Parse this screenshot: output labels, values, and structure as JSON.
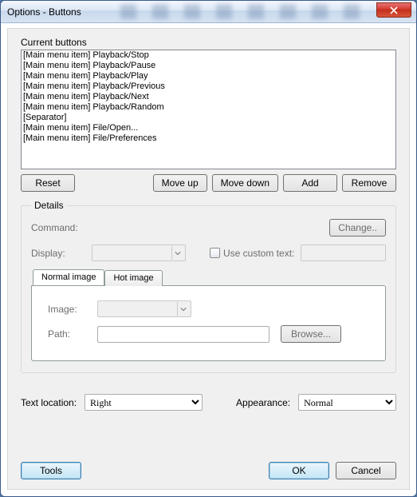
{
  "window": {
    "title": "Options - Buttons"
  },
  "section_label": "Current buttons",
  "current_buttons": [
    "[Main menu item] Playback/Stop",
    "[Main menu item] Playback/Pause",
    "[Main menu item] Playback/Play",
    "[Main menu item] Playback/Previous",
    "[Main menu item] Playback/Next",
    "[Main menu item] Playback/Random",
    "[Separator]",
    "[Main menu item] File/Open...",
    "[Main menu item] File/Preferences"
  ],
  "buttons": {
    "reset": "Reset",
    "move_up": "Move up",
    "move_down": "Move down",
    "add": "Add",
    "remove": "Remove"
  },
  "details": {
    "legend": "Details",
    "command_label": "Command:",
    "change": "Change..",
    "display_label": "Display:",
    "use_custom_text": "Use custom text:",
    "tabs": {
      "normal": "Normal image",
      "hot": "Hot image"
    },
    "image_label": "Image:",
    "path_label": "Path:",
    "browse": "Browse..."
  },
  "bottom": {
    "text_location_label": "Text location:",
    "text_location_value": "Right",
    "appearance_label": "Appearance:",
    "appearance_value": "Normal"
  },
  "actions": {
    "tools": "Tools",
    "ok": "OK",
    "cancel": "Cancel"
  }
}
